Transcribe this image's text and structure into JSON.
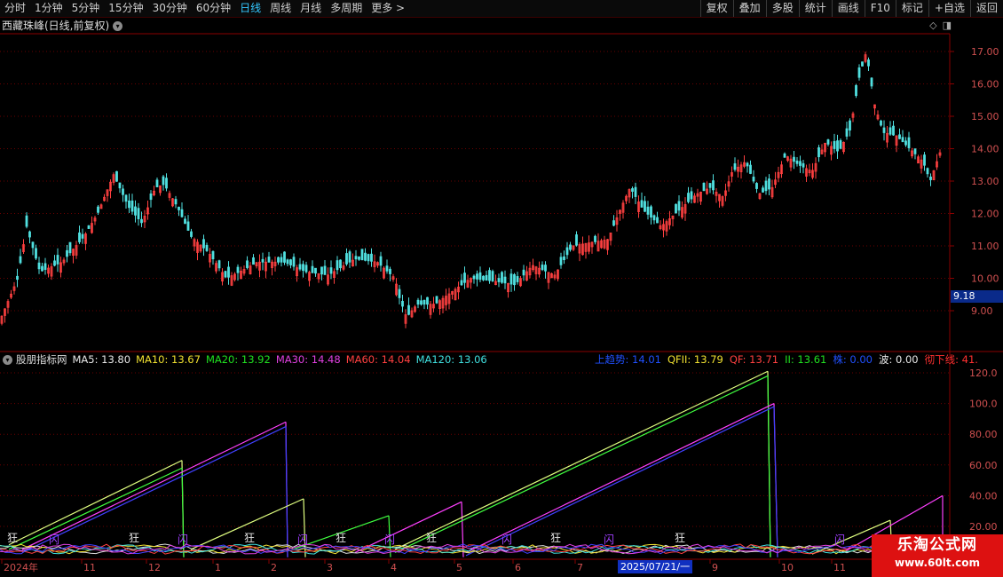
{
  "toolbar": {
    "periods": [
      "分时",
      "1分钟",
      "5分钟",
      "15分钟",
      "30分钟",
      "60分钟",
      "日线",
      "周线",
      "月线",
      "多周期",
      "更多 >"
    ],
    "active_period": "日线",
    "actions": [
      "复权",
      "叠加",
      "多股",
      "统计",
      "画线",
      "F10",
      "标记",
      "+自选",
      "返回"
    ]
  },
  "stock": {
    "title": "西藏珠峰(日线,前复权)"
  },
  "price_axis": {
    "ticks": [
      "17.00",
      "16.00",
      "15.00",
      "14.00",
      "13.00",
      "12.00",
      "11.00",
      "10.00",
      "9.00"
    ],
    "current_price": "9.18"
  },
  "indicator": {
    "name": "股朋指标网",
    "ma": [
      {
        "label": "MA5: 13.80",
        "color": "#e8e8e8"
      },
      {
        "label": "MA10: 13.67",
        "color": "#f0e030"
      },
      {
        "label": "MA20: 13.92",
        "color": "#20e020"
      },
      {
        "label": "MA30: 14.48",
        "color": "#e040e0"
      },
      {
        "label": "MA60: 14.04",
        "color": "#ff4040"
      },
      {
        "label": "MA120: 13.06",
        "color": "#40e0e0"
      }
    ],
    "right": [
      {
        "label": "上趋势: 14.01",
        "color": "#2050ff"
      },
      {
        "label": "QFII: 13.79",
        "color": "#f0e030"
      },
      {
        "label": "QF: 13.71",
        "color": "#ff4040"
      },
      {
        "label": "II: 13.61",
        "color": "#20e020"
      },
      {
        "label": "株: 0.00",
        "color": "#2050ff"
      },
      {
        "label": "波: 0.00",
        "color": "#e8e8e8"
      },
      {
        "label": "彻下线: 41.",
        "color": "#ff3030"
      }
    ],
    "axis_ticks": [
      "120.0",
      "100.0",
      "80.00",
      "60.00",
      "40.00",
      "20.00"
    ]
  },
  "date_axis": {
    "labels": [
      "2024年",
      "11",
      "12",
      "1",
      "2",
      "3",
      "4",
      "5",
      "6",
      "7",
      "9",
      "10",
      "11"
    ],
    "highlight": "2025/07/21/一"
  },
  "signal_labels": [
    "狂",
    "闪",
    "狂",
    "闪",
    "狂",
    "闪",
    "狂",
    "闪",
    "狂",
    "闪",
    "狂",
    "闪",
    "狂",
    "闪"
  ],
  "watermark": {
    "title": "乐淘公式网",
    "url": "www.60lt.com"
  },
  "colors": {
    "up": "#ff4040",
    "down": "#50e0e0",
    "grid": "#8a0000"
  }
}
